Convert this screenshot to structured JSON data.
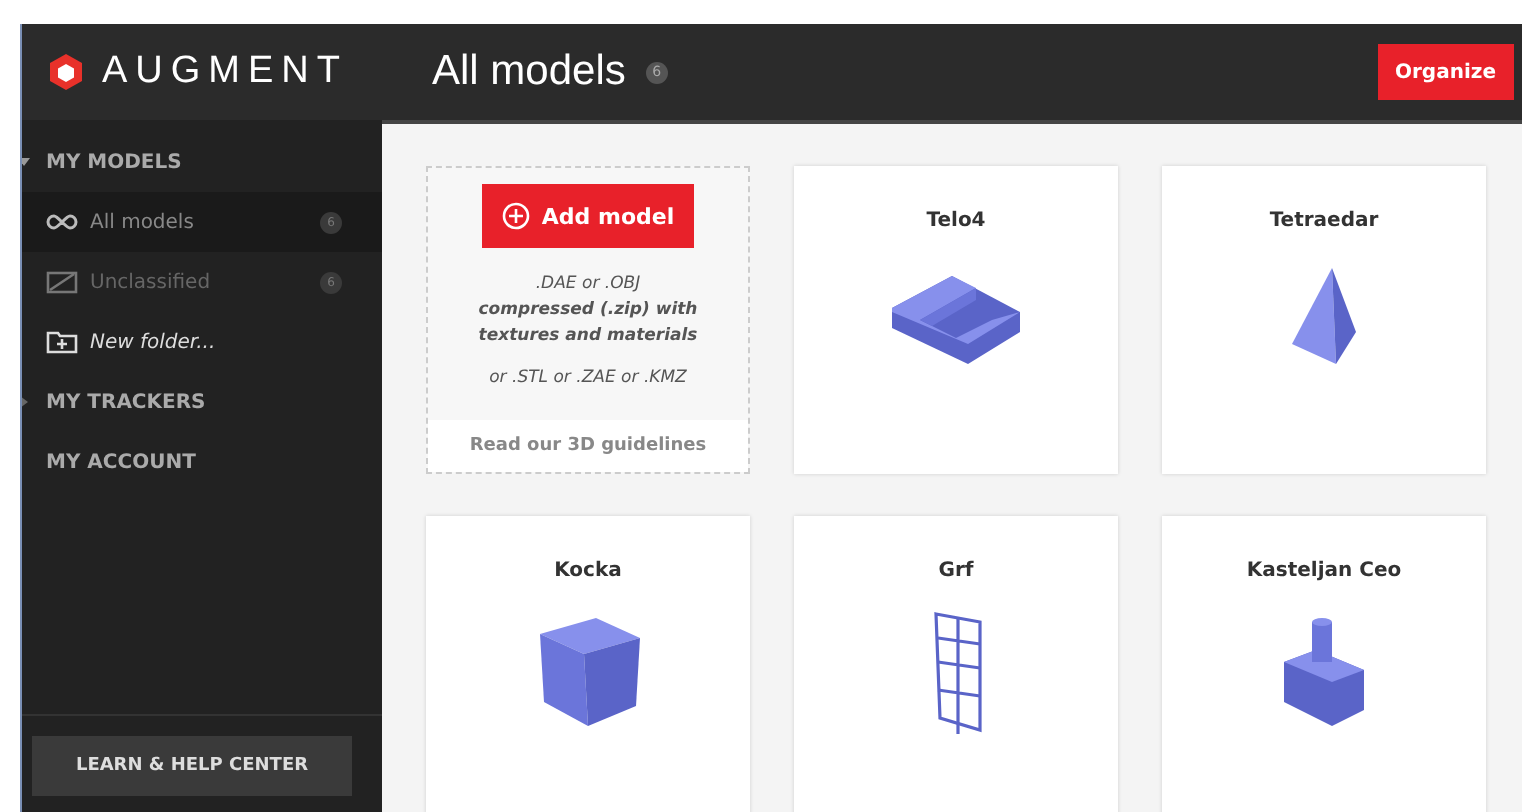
{
  "header": {
    "brand": "AUGMENT",
    "title": "All models",
    "count": "6",
    "organize_button": "Organize"
  },
  "sidebar": {
    "sections": [
      {
        "label": "MY MODELS",
        "expanded": true,
        "items": [
          {
            "label": "All models",
            "kind": "all",
            "count": "6",
            "selected": true
          },
          {
            "label": "Unclassified",
            "kind": "folder",
            "count": "6",
            "selected": false
          },
          {
            "label": "New folder...",
            "kind": "new",
            "selected": false
          }
        ]
      },
      {
        "label": "MY TRACKERS",
        "expanded": false
      },
      {
        "label": "MY ACCOUNT"
      }
    ],
    "help_button": "LEARN & HELP CENTER"
  },
  "upload_card": {
    "button": "Add model",
    "lines": [
      ".DAE or .OBJ",
      "**compressed (.zip) with textures and materials**",
      "or .STL or .ZAE or .KMZ"
    ],
    "guidelines_link": "Read our 3D guidelines"
  },
  "models": [
    {
      "name": "Telo4",
      "kind": "stairs"
    },
    {
      "name": "Tetraedar",
      "kind": "pyramid"
    },
    {
      "name": "Kocka",
      "kind": "cube"
    },
    {
      "name": "Grf",
      "kind": "window"
    },
    {
      "name": "Kasteljan Ceo",
      "kind": "castle"
    }
  ]
}
